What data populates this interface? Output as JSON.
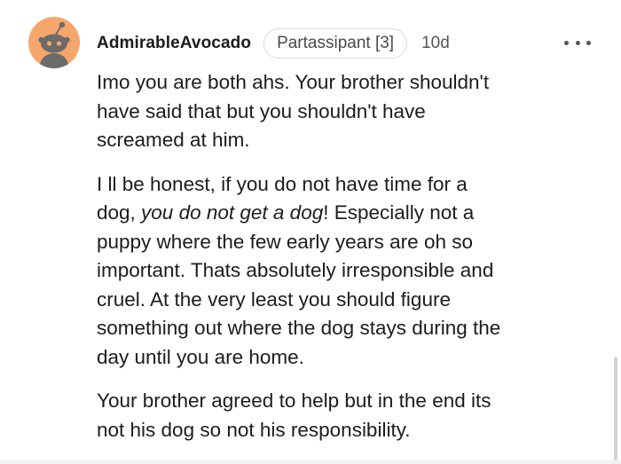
{
  "comment": {
    "username": "AdmirableAvocado",
    "flair": "Partassipant [3]",
    "timestamp": "10d",
    "avatar_icon": "reddit-snoo-avatar-icon",
    "more_icon": "more-options-icon",
    "paragraphs": [
      {
        "lines": [
          "Imo you are both ahs. Your brother shouldn't",
          "have said that but you shouldn't have",
          "screamed at him."
        ]
      },
      {
        "lines": [
          "I ll be honest, if you do not have time for a",
          "important. Thats absolutely irresponsible and",
          "cruel. At the very least you should figure",
          "something out where the dog stays during the",
          "day until you are home."
        ],
        "line2": {
          "before": "dog, ",
          "italic": "you do not get a dog",
          "after": "! Especially not a"
        },
        "line3": "puppy where the few early years are oh so"
      },
      {
        "lines": [
          "Your brother agreed to help but in the end its",
          "not his dog so not his responsibility."
        ]
      }
    ]
  },
  "colors": {
    "avatar_bg": "#f5a66a",
    "text": "#1c1c1c",
    "meta_text": "#555555",
    "flair_border": "#d9d9d9"
  }
}
